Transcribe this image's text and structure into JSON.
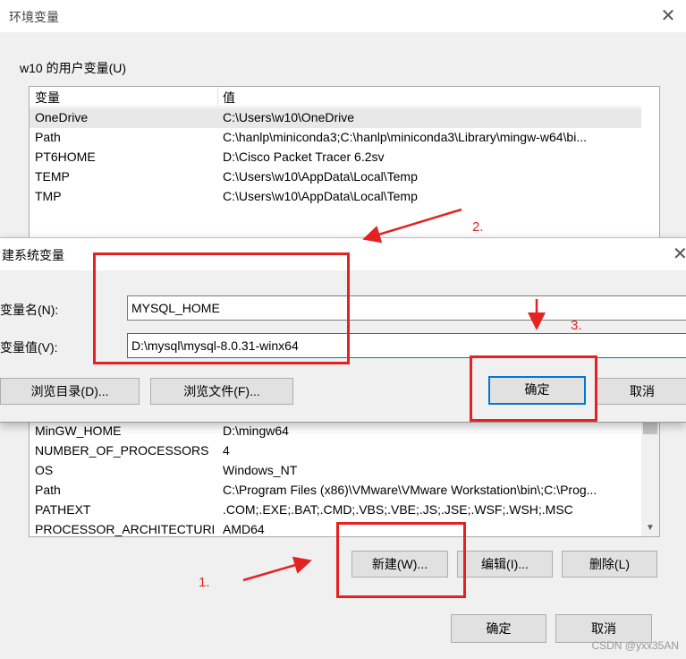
{
  "outer_dialog": {
    "title": "环境变量",
    "user_group_label": "w10 的用户变量(U)",
    "user_table": {
      "col_var": "变量",
      "col_val": "值",
      "rows": [
        {
          "name": "OneDrive",
          "value": "C:\\Users\\w10\\OneDrive"
        },
        {
          "name": "Path",
          "value": "C:\\hanlp\\miniconda3;C:\\hanlp\\miniconda3\\Library\\mingw-w64\\bi..."
        },
        {
          "name": "PT6HOME",
          "value": "D:\\Cisco Packet Tracer 6.2sv"
        },
        {
          "name": "TEMP",
          "value": "C:\\Users\\w10\\AppData\\Local\\Temp"
        },
        {
          "name": "TMP",
          "value": "C:\\Users\\w10\\AppData\\Local\\Temp"
        }
      ]
    },
    "system_table": {
      "rows": [
        {
          "name": "MinGW_HOME",
          "value": "D:\\mingw64"
        },
        {
          "name": "NUMBER_OF_PROCESSORS",
          "value": "4"
        },
        {
          "name": "OS",
          "value": "Windows_NT"
        },
        {
          "name": "Path",
          "value": "C:\\Program Files (x86)\\VMware\\VMware Workstation\\bin\\;C:\\Prog..."
        },
        {
          "name": "PATHEXT",
          "value": ".COM;.EXE;.BAT;.CMD;.VBS;.VBE;.JS;.JSE;.WSF;.WSH;.MSC"
        },
        {
          "name": "PROCESSOR_ARCHITECTURE",
          "value": "AMD64"
        }
      ]
    },
    "buttons": {
      "new": "新建(W)...",
      "edit": "编辑(I)...",
      "delete": "删除(L)",
      "ok": "确定",
      "cancel": "取消"
    }
  },
  "inner_dialog": {
    "title": "建系统变量",
    "name_label": "变量名(N):",
    "name_value": "MYSQL_HOME",
    "value_label": "变量值(V):",
    "value_value": "D:\\mysql\\mysql-8.0.31-winx64",
    "browse_dir": "浏览目录(D)...",
    "browse_file": "浏览文件(F)...",
    "ok": "确定",
    "cancel": "取消"
  },
  "annotations": {
    "step1": "1.",
    "step2": "2.",
    "step3": "3.",
    "color": "#e52222"
  },
  "watermark": "CSDN @yxx35AN"
}
